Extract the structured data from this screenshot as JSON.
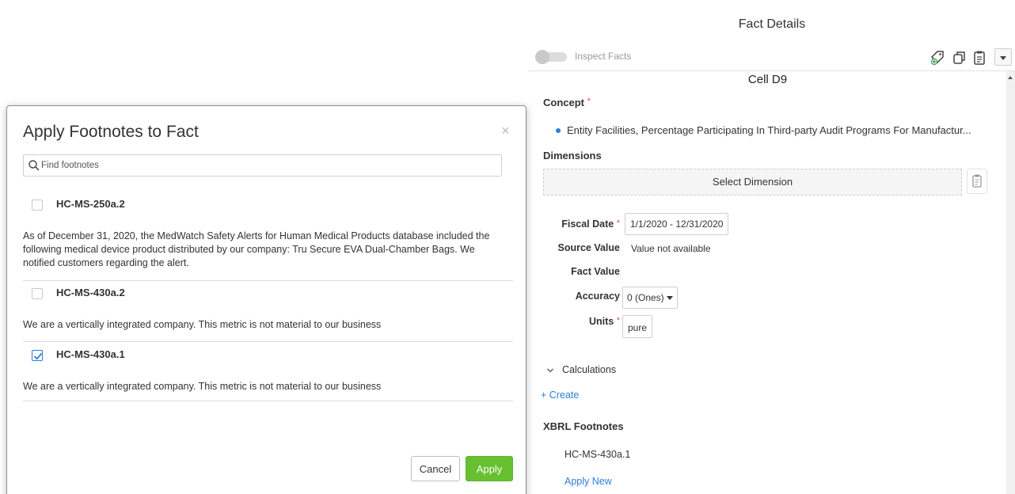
{
  "fact_details": {
    "title": "Fact Details",
    "inspect_label": "Inspect Facts",
    "cell_title": "Cell D9",
    "concept_label": "Concept",
    "concept_value": "Entity Facilities, Percentage Participating In Third-party Audit Programs For Manufactur...",
    "dimensions_label": "Dimensions",
    "select_dimension": "Select Dimension",
    "fiscal_date_label": "Fiscal Date",
    "fiscal_date_value": "1/1/2020 - 12/31/2020",
    "source_value_label": "Source Value",
    "source_value_value": "Value not available",
    "fact_value_label": "Fact Value",
    "accuracy_label": "Accuracy",
    "accuracy_value": "0 (Ones)",
    "units_label": "Units",
    "units_value": "pure",
    "calculations_label": "Calculations",
    "create_link": "+ Create",
    "xbrl_footnotes_label": "XBRL Footnotes",
    "footnote_item": "HC-MS-430a.1",
    "apply_new_link": "Apply New",
    "required_mark": "*",
    "icons": [
      "tag-add-icon",
      "copy-icon",
      "clipboard-icon",
      "chevron-down-icon"
    ]
  },
  "modal": {
    "title": "Apply Footnotes to Fact",
    "close_symbol": "×",
    "search_placeholder": "Find footnotes",
    "footnotes": [
      {
        "code": "HC-MS-250a.2",
        "checked": false,
        "text": "As of December 31, 2020, the MedWatch Safety Alerts for Human Medical Products database included the following medical device product distributed by our company: Tru Secure EVA Dual-Chamber Bags. We notified customers regarding the alert."
      },
      {
        "code": "HC-MS-430a.2",
        "checked": false,
        "text": "We are a vertically integrated company. This metric is not material to our business"
      },
      {
        "code": "HC-MS-430a.1",
        "checked": true,
        "text": "We are a vertically integrated company. This metric is not material to our business"
      }
    ],
    "cancel_label": "Cancel",
    "apply_label": "Apply",
    "colors": {
      "apply": "#66c030",
      "link": "#2a7fd4",
      "checkbox_checked": "#2a7fd4"
    }
  }
}
